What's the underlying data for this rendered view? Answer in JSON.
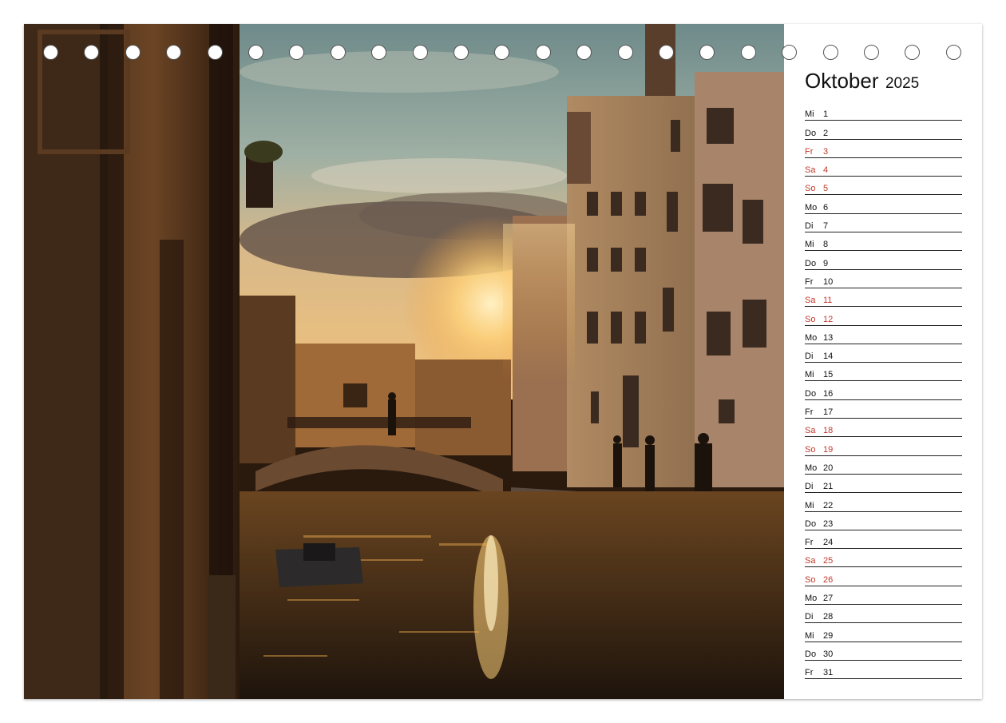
{
  "calendar": {
    "month": "Oktober",
    "year": "2025",
    "weekend_color": "#c0392b",
    "days": [
      {
        "weekday": "Mi",
        "day": "1",
        "weekend": false
      },
      {
        "weekday": "Do",
        "day": "2",
        "weekend": false
      },
      {
        "weekday": "Fr",
        "day": "3",
        "weekend": true
      },
      {
        "weekday": "Sa",
        "day": "4",
        "weekend": true
      },
      {
        "weekday": "So",
        "day": "5",
        "weekend": true
      },
      {
        "weekday": "Mo",
        "day": "6",
        "weekend": false
      },
      {
        "weekday": "Di",
        "day": "7",
        "weekend": false
      },
      {
        "weekday": "Mi",
        "day": "8",
        "weekend": false
      },
      {
        "weekday": "Do",
        "day": "9",
        "weekend": false
      },
      {
        "weekday": "Fr",
        "day": "10",
        "weekend": false
      },
      {
        "weekday": "Sa",
        "day": "11",
        "weekend": true
      },
      {
        "weekday": "So",
        "day": "12",
        "weekend": true
      },
      {
        "weekday": "Mo",
        "day": "13",
        "weekend": false
      },
      {
        "weekday": "Di",
        "day": "14",
        "weekend": false
      },
      {
        "weekday": "Mi",
        "day": "15",
        "weekend": false
      },
      {
        "weekday": "Do",
        "day": "16",
        "weekend": false
      },
      {
        "weekday": "Fr",
        "day": "17",
        "weekend": false
      },
      {
        "weekday": "Sa",
        "day": "18",
        "weekend": true
      },
      {
        "weekday": "So",
        "day": "19",
        "weekend": true
      },
      {
        "weekday": "Mo",
        "day": "20",
        "weekend": false
      },
      {
        "weekday": "Di",
        "day": "21",
        "weekend": false
      },
      {
        "weekday": "Mi",
        "day": "22",
        "weekend": false
      },
      {
        "weekday": "Do",
        "day": "23",
        "weekend": false
      },
      {
        "weekday": "Fr",
        "day": "24",
        "weekend": false
      },
      {
        "weekday": "Sa",
        "day": "25",
        "weekend": true
      },
      {
        "weekday": "So",
        "day": "26",
        "weekend": true
      },
      {
        "weekday": "Mo",
        "day": "27",
        "weekend": false
      },
      {
        "weekday": "Di",
        "day": "28",
        "weekend": false
      },
      {
        "weekday": "Mi",
        "day": "29",
        "weekend": false
      },
      {
        "weekday": "Do",
        "day": "30",
        "weekend": false
      },
      {
        "weekday": "Fr",
        "day": "31",
        "weekend": false
      }
    ]
  },
  "photo": {
    "subject": "venice-canal-sunset-photo"
  }
}
